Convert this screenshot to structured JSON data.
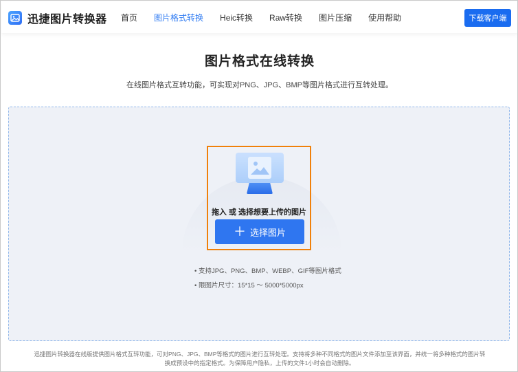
{
  "app": {
    "name": "迅捷图片转换器"
  },
  "nav": {
    "items": [
      {
        "label": "首页",
        "active": false
      },
      {
        "label": "图片格式转换",
        "active": true
      },
      {
        "label": "Heic转换",
        "active": false
      },
      {
        "label": "Raw转换",
        "active": false
      },
      {
        "label": "图片压缩",
        "active": false
      },
      {
        "label": "使用帮助",
        "active": false
      }
    ],
    "download_label": "下载客户端"
  },
  "main": {
    "title": "图片格式在线转换",
    "subtitle": "在线图片格式互转功能，可实现对PNG、JPG、BMP等图片格式进行互转处理。"
  },
  "upload": {
    "drop_text": "拖入 或 选择想要上传的图片",
    "button_label": "选择图片",
    "tips": [
      "• 支持JPG、PNG、BMP、WEBP、GIF等图片格式",
      "• 限图片尺寸：15*15 ～ 5000*5000px"
    ]
  },
  "footer": {
    "line1": "迅捷图片转换器在线版提供图片格式互转功能，可对PNG、JPG、BMP等格式的图片进行互转处理。支持将多种不同格式的图片文件添加至该界面，并统一将多种格式的图片转",
    "line2": "换成预设中的指定格式。为保障用户隐私，上传的文件1小时会自动删除。"
  },
  "colors": {
    "accent": "#2f7bf2",
    "button": "#2f76f0",
    "highlight_border": "#f0800a",
    "dropzone_bg": "#eef1f7"
  }
}
